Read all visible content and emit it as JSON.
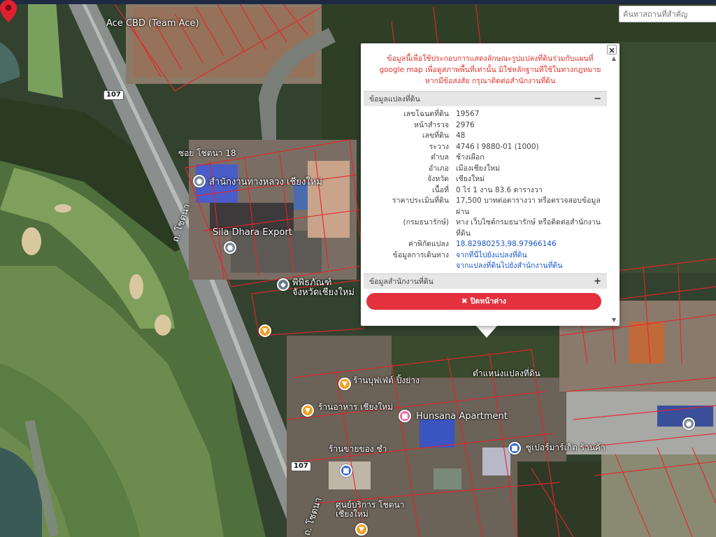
{
  "search": {
    "placeholder": "ค้นหาสถานที่สำคัญ"
  },
  "map": {
    "labels": [
      {
        "id": "ace_cbd",
        "text": "Ace CBD (Team Ace)"
      },
      {
        "id": "soi_chotana18",
        "text": "ซอย โชตนา 18"
      },
      {
        "id": "highway_office",
        "text": "สำนักงานทางหลวง เชียงใหม่"
      },
      {
        "id": "sila_dhara",
        "text": "Sila Dhara Export"
      },
      {
        "id": "museum",
        "text": "พิพิธภัณฑ์ จังหวัดเชียงใหม่"
      },
      {
        "id": "chotana_rd",
        "text": "ถ. โชตนา"
      },
      {
        "id": "chotana_rd2",
        "text": "ถ. โชตนา"
      },
      {
        "id": "land_location",
        "text": "ตำแหน่งแปลงที่ดิน"
      },
      {
        "id": "cafe1",
        "text": "ร้านบุฟเฟ่ต์ ปิ้งย่าง"
      },
      {
        "id": "cafe2",
        "text": "ร้านอาหาร เชียงใหม่"
      },
      {
        "id": "hunsana",
        "text": "Hunsana Apartment"
      },
      {
        "id": "shop1",
        "text": "ร้านขายของ ชำ"
      },
      {
        "id": "shop2",
        "text": "ซูเปอร์มาร์เก็ต ร้านค้า"
      },
      {
        "id": "chotana_shop",
        "text": "ศูนย์บริการ โชตนา เชียงใหม่"
      }
    ],
    "road_shields": [
      "107",
      "107"
    ]
  },
  "popup": {
    "disclaimer": "ข้อมูลนี้เพื่อใช้ประกอบการแสดงลักษณะรูปแปลงที่ดินร่วมกับแผนที่ google map เพื่อดูสภาพพื้นที่เท่านั้น มิใช่หลักฐานที่ใช้ในทางกฎหมาย หากมีข้อสงสัย กรุณาติดต่อสำนักงานที่ดิน",
    "parcel_section": {
      "title": "ข้อมูลแปลงที่ดิน",
      "toggle": "−"
    },
    "rows": [
      {
        "key": "เลขโฉนดที่ดิน",
        "value": "19567"
      },
      {
        "key": "หน้าสำรวจ",
        "value": "2976"
      },
      {
        "key": "เลขที่ดิน",
        "value": "48"
      },
      {
        "key": "ระวาง",
        "value": "4746 I 9880-01 (1000)"
      },
      {
        "key": "ตำบล",
        "value": "ช้างเผือก"
      },
      {
        "key": "อำเภอ",
        "value": "เมืองเชียงใหม่"
      },
      {
        "key": "จังหวัด",
        "value": "เชียงใหม่"
      },
      {
        "key": "เนื้อที่",
        "value": "0 ไร่ 1 งาน 83.6 ตารางวา"
      },
      {
        "key": "ราคาประเมินที่ดิน",
        "value": "17,500 บาทต่อตารางวา หรือตรวจสอบข้อมูลผ่าน"
      },
      {
        "key": "(กรมธนารักษ์)",
        "value": "ทาง เว็บไซต์กรมธนารักษ์ หรือติดต่อสำนักงานที่ดิน"
      },
      {
        "key": "ค่าพิกัดแปลง",
        "value": "18.82980253,98.97966146",
        "link": true
      },
      {
        "key": "ข้อมูลการเดินทาง",
        "value": "จากที่นี่ไปยังแปลงที่ดิน",
        "link": true
      },
      {
        "key": "",
        "value": "จากแปลงที่ดินไปยังสำนักงานที่ดิน",
        "link": true
      }
    ],
    "office_section": {
      "title": "ข้อมูลสำนักงานที่ดิน",
      "toggle": "+"
    },
    "close_button": {
      "icon": "✖",
      "label": "ปิดหน้าต่าง"
    },
    "close_x": "×"
  },
  "colors": {
    "accent_red": "#e5303e",
    "link_blue": "#1a56c8",
    "parcel_line": "#e8232d"
  }
}
